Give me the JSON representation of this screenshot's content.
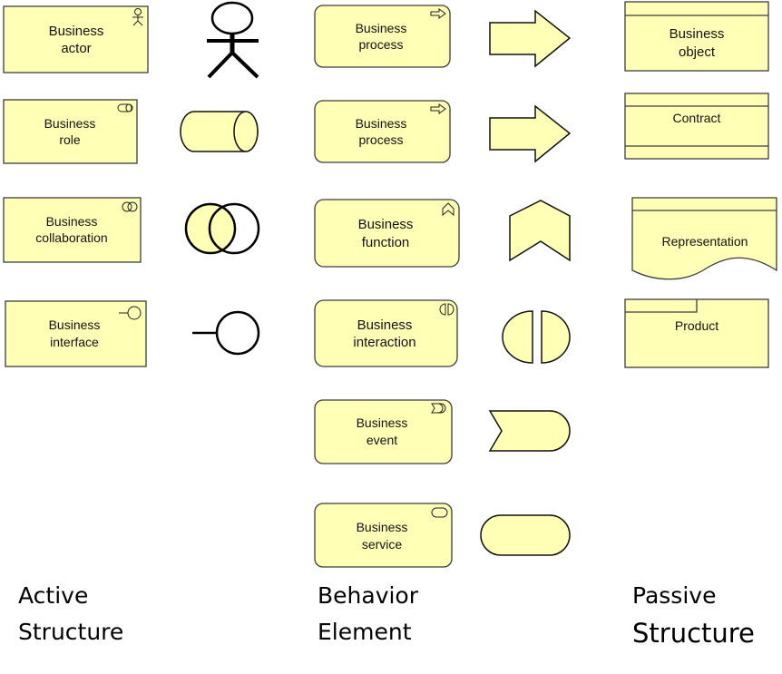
{
  "fill_color": "#ffffb5",
  "active": {
    "actor": [
      "Business",
      "actor"
    ],
    "role": [
      "Business",
      "role"
    ],
    "collaboration": [
      "Business",
      "collaboration"
    ],
    "interface": [
      "Business",
      "interface"
    ]
  },
  "behavior": {
    "process1": [
      "Business",
      "process"
    ],
    "process2": [
      "Business",
      "process"
    ],
    "function": [
      "Business",
      "function"
    ],
    "interaction": [
      "Business",
      "interaction"
    ],
    "event": [
      "Business",
      "event"
    ],
    "service": [
      "Business",
      "service"
    ]
  },
  "passive": {
    "object": [
      "Business",
      "object"
    ],
    "contract": "Contract",
    "representation": "Representation",
    "product": "Product"
  },
  "captions": {
    "active": [
      "Active",
      "Structure"
    ],
    "behavior": [
      "Behavior",
      "Element"
    ],
    "passive": [
      "Passive",
      "Structure"
    ]
  }
}
